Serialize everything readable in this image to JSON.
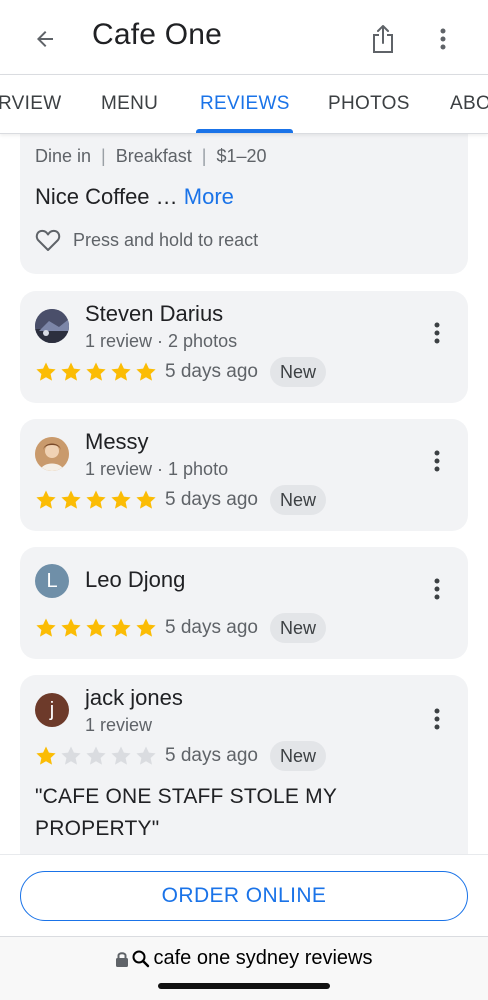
{
  "header": {
    "title": "Cafe One"
  },
  "tabs": [
    {
      "label": "RVIEW"
    },
    {
      "label": "MENU"
    },
    {
      "label": "REVIEWS",
      "active": true
    },
    {
      "label": "PHOTOS"
    },
    {
      "label": "ABO"
    }
  ],
  "summary_card": {
    "dine_type": "Dine in",
    "meal": "Breakfast",
    "price": "$1–20",
    "snippet": "Nice Coffee …",
    "more_label": "More",
    "react_label": "Press and hold to react"
  },
  "reviews": [
    {
      "name": "Steven Darius",
      "sub": "1 review · 2 photos",
      "rating": 5,
      "ago": "5 days ago",
      "badge": "New"
    },
    {
      "name": "Messy",
      "sub": "1 review · 1 photo",
      "rating": 5,
      "ago": "5 days ago",
      "badge": "New"
    },
    {
      "name": "Leo Djong",
      "sub": "",
      "avatar_letter": "L",
      "rating": 5,
      "ago": "5 days ago",
      "badge": "New"
    },
    {
      "name": "jack jones",
      "sub": "1 review",
      "avatar_letter": "j",
      "rating": 1,
      "ago": "5 days ago",
      "badge": "New",
      "text": "\"CAFE ONE STAFF STOLE MY PROPERTY\""
    }
  ],
  "order": {
    "label": "ORDER ONLINE"
  },
  "browser": {
    "url_text": "cafe one sydney reviews"
  },
  "colors": {
    "accent": "#1a73e8",
    "star_filled": "#fbbc04",
    "star_empty": "#dadce0",
    "card_bg": "#f2f3f5"
  }
}
